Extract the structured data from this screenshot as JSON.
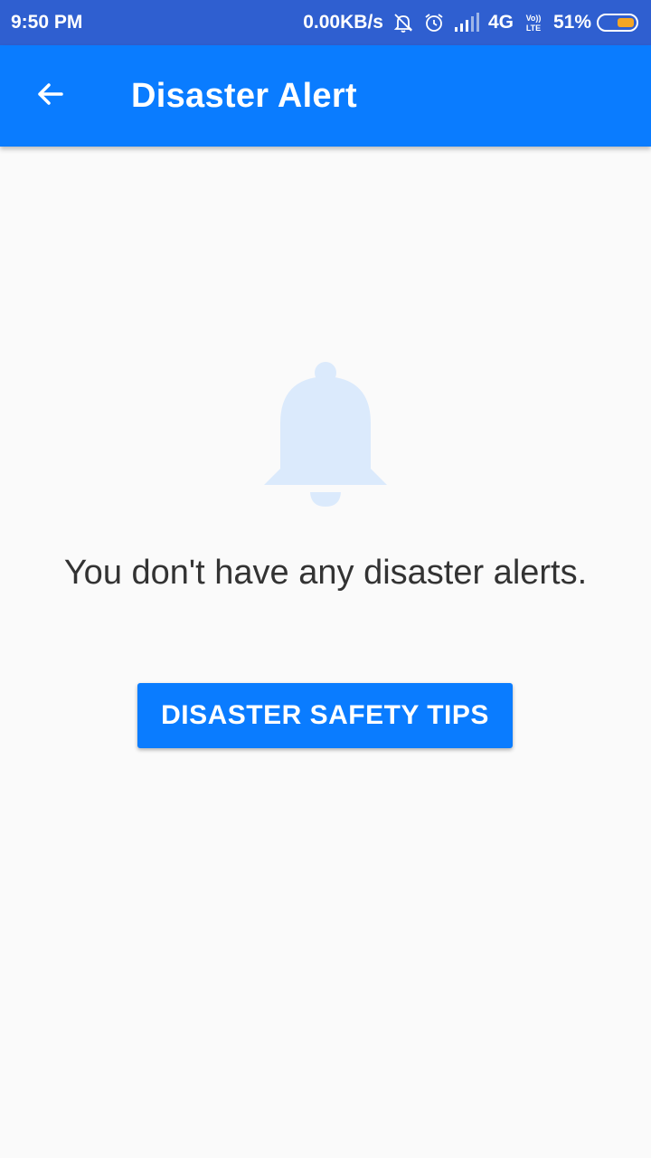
{
  "status_bar": {
    "time": "9:50 PM",
    "network_speed": "0.00KB/s",
    "network_type": "4G",
    "volte_label_top": "Vo))",
    "volte_label_bottom": "LTE",
    "battery_percent": "51%",
    "icons": [
      "muted-bell-icon",
      "alarm-icon",
      "signal-icon",
      "volte-icon",
      "battery-icon"
    ],
    "battery_level": 0.51,
    "battery_fill_color": "#f5a623"
  },
  "app_bar": {
    "title": "Disaster Alert",
    "back_icon": "arrow-left-icon",
    "color": "#0a7cff"
  },
  "empty_state": {
    "icon": "bell-icon",
    "icon_color": "#dbeafc",
    "message": "You don't have any disaster alerts."
  },
  "actions": {
    "safety_tips_label": "DISASTER SAFETY TIPS"
  }
}
